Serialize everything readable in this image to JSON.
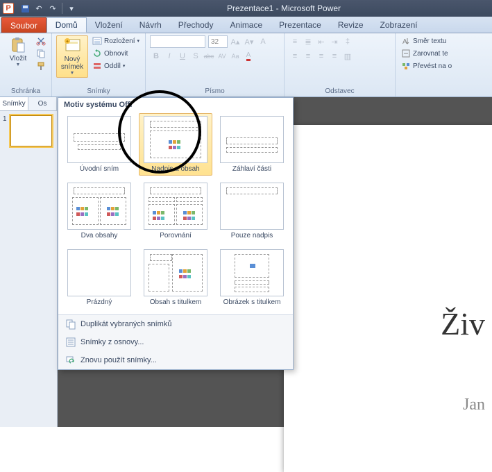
{
  "titlebar": {
    "title": "Prezentace1 - Microsoft Power"
  },
  "tabs": {
    "file": "Soubor",
    "items": [
      "Domů",
      "Vložení",
      "Návrh",
      "Přechody",
      "Animace",
      "Prezentace",
      "Revize",
      "Zobrazení"
    ],
    "active": 0
  },
  "ribbon": {
    "clipboard": {
      "paste": "Vložit",
      "title": "Schránka"
    },
    "slides": {
      "new": "Nový snímek",
      "layout": "Rozložení",
      "reset": "Obnovit",
      "section": "Oddíl",
      "title": "Snímky"
    },
    "font": {
      "size_placeholder": "32",
      "buttons": [
        "B",
        "I",
        "U",
        "S",
        "abc",
        "AV",
        "Aa"
      ],
      "title": "Písmo"
    },
    "paragraph": {
      "title": "Odstavec"
    },
    "drawing": {
      "textdir": "Směr textu",
      "align": "Zarovnat te",
      "convert": "Převést na o"
    }
  },
  "panel": {
    "tab_slides": "Snímky",
    "tab_outline": "Os",
    "slide_numbers": [
      "1"
    ]
  },
  "gallery": {
    "header": "Motiv systému Offi",
    "layouts": [
      "Úvodní sním",
      "Nadpis a obsah",
      "Záhlaví části",
      "Dva obsahy",
      "Porovnání",
      "Pouze nadpis",
      "Prázdný",
      "Obsah s titulkem",
      "Obrázek s titulkem"
    ],
    "footer": {
      "duplicate": "Duplikát vybraných snímků",
      "outline": "Snímky z osnovy...",
      "reuse": "Znovu použít snímky..."
    }
  },
  "slide": {
    "title": "Živ",
    "subtitle": "Jan"
  }
}
